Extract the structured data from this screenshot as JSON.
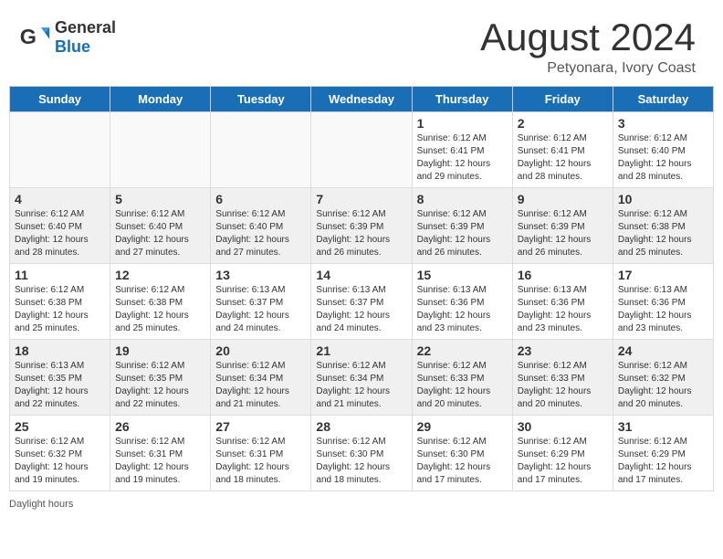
{
  "header": {
    "logo_general": "General",
    "logo_blue": "Blue",
    "month_year": "August 2024",
    "location": "Petyonara, Ivory Coast"
  },
  "days_of_week": [
    "Sunday",
    "Monday",
    "Tuesday",
    "Wednesday",
    "Thursday",
    "Friday",
    "Saturday"
  ],
  "weeks": [
    [
      {
        "day": "",
        "info": ""
      },
      {
        "day": "",
        "info": ""
      },
      {
        "day": "",
        "info": ""
      },
      {
        "day": "",
        "info": ""
      },
      {
        "day": "1",
        "info": "Sunrise: 6:12 AM\nSunset: 6:41 PM\nDaylight: 12 hours\nand 29 minutes."
      },
      {
        "day": "2",
        "info": "Sunrise: 6:12 AM\nSunset: 6:41 PM\nDaylight: 12 hours\nand 28 minutes."
      },
      {
        "day": "3",
        "info": "Sunrise: 6:12 AM\nSunset: 6:40 PM\nDaylight: 12 hours\nand 28 minutes."
      }
    ],
    [
      {
        "day": "4",
        "info": "Sunrise: 6:12 AM\nSunset: 6:40 PM\nDaylight: 12 hours\nand 28 minutes."
      },
      {
        "day": "5",
        "info": "Sunrise: 6:12 AM\nSunset: 6:40 PM\nDaylight: 12 hours\nand 27 minutes."
      },
      {
        "day": "6",
        "info": "Sunrise: 6:12 AM\nSunset: 6:40 PM\nDaylight: 12 hours\nand 27 minutes."
      },
      {
        "day": "7",
        "info": "Sunrise: 6:12 AM\nSunset: 6:39 PM\nDaylight: 12 hours\nand 26 minutes."
      },
      {
        "day": "8",
        "info": "Sunrise: 6:12 AM\nSunset: 6:39 PM\nDaylight: 12 hours\nand 26 minutes."
      },
      {
        "day": "9",
        "info": "Sunrise: 6:12 AM\nSunset: 6:39 PM\nDaylight: 12 hours\nand 26 minutes."
      },
      {
        "day": "10",
        "info": "Sunrise: 6:12 AM\nSunset: 6:38 PM\nDaylight: 12 hours\nand 25 minutes."
      }
    ],
    [
      {
        "day": "11",
        "info": "Sunrise: 6:12 AM\nSunset: 6:38 PM\nDaylight: 12 hours\nand 25 minutes."
      },
      {
        "day": "12",
        "info": "Sunrise: 6:12 AM\nSunset: 6:38 PM\nDaylight: 12 hours\nand 25 minutes."
      },
      {
        "day": "13",
        "info": "Sunrise: 6:13 AM\nSunset: 6:37 PM\nDaylight: 12 hours\nand 24 minutes."
      },
      {
        "day": "14",
        "info": "Sunrise: 6:13 AM\nSunset: 6:37 PM\nDaylight: 12 hours\nand 24 minutes."
      },
      {
        "day": "15",
        "info": "Sunrise: 6:13 AM\nSunset: 6:36 PM\nDaylight: 12 hours\nand 23 minutes."
      },
      {
        "day": "16",
        "info": "Sunrise: 6:13 AM\nSunset: 6:36 PM\nDaylight: 12 hours\nand 23 minutes."
      },
      {
        "day": "17",
        "info": "Sunrise: 6:13 AM\nSunset: 6:36 PM\nDaylight: 12 hours\nand 23 minutes."
      }
    ],
    [
      {
        "day": "18",
        "info": "Sunrise: 6:13 AM\nSunset: 6:35 PM\nDaylight: 12 hours\nand 22 minutes."
      },
      {
        "day": "19",
        "info": "Sunrise: 6:12 AM\nSunset: 6:35 PM\nDaylight: 12 hours\nand 22 minutes."
      },
      {
        "day": "20",
        "info": "Sunrise: 6:12 AM\nSunset: 6:34 PM\nDaylight: 12 hours\nand 21 minutes."
      },
      {
        "day": "21",
        "info": "Sunrise: 6:12 AM\nSunset: 6:34 PM\nDaylight: 12 hours\nand 21 minutes."
      },
      {
        "day": "22",
        "info": "Sunrise: 6:12 AM\nSunset: 6:33 PM\nDaylight: 12 hours\nand 20 minutes."
      },
      {
        "day": "23",
        "info": "Sunrise: 6:12 AM\nSunset: 6:33 PM\nDaylight: 12 hours\nand 20 minutes."
      },
      {
        "day": "24",
        "info": "Sunrise: 6:12 AM\nSunset: 6:32 PM\nDaylight: 12 hours\nand 20 minutes."
      }
    ],
    [
      {
        "day": "25",
        "info": "Sunrise: 6:12 AM\nSunset: 6:32 PM\nDaylight: 12 hours\nand 19 minutes."
      },
      {
        "day": "26",
        "info": "Sunrise: 6:12 AM\nSunset: 6:31 PM\nDaylight: 12 hours\nand 19 minutes."
      },
      {
        "day": "27",
        "info": "Sunrise: 6:12 AM\nSunset: 6:31 PM\nDaylight: 12 hours\nand 18 minutes."
      },
      {
        "day": "28",
        "info": "Sunrise: 6:12 AM\nSunset: 6:30 PM\nDaylight: 12 hours\nand 18 minutes."
      },
      {
        "day": "29",
        "info": "Sunrise: 6:12 AM\nSunset: 6:30 PM\nDaylight: 12 hours\nand 17 minutes."
      },
      {
        "day": "30",
        "info": "Sunrise: 6:12 AM\nSunset: 6:29 PM\nDaylight: 12 hours\nand 17 minutes."
      },
      {
        "day": "31",
        "info": "Sunrise: 6:12 AM\nSunset: 6:29 PM\nDaylight: 12 hours\nand 17 minutes."
      }
    ]
  ],
  "footer": {
    "daylight_label": "Daylight hours"
  }
}
